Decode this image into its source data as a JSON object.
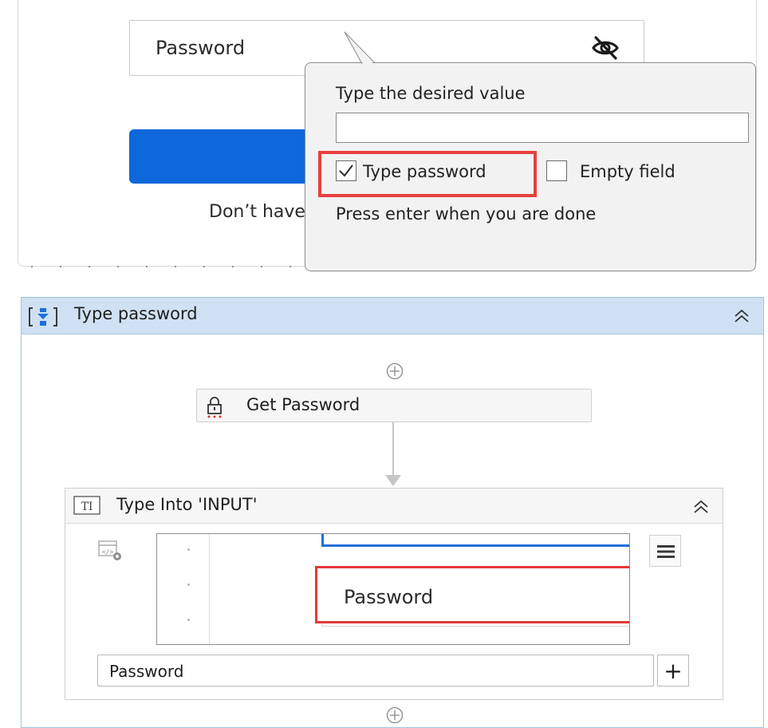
{
  "login_form": {
    "password_placeholder": "Password",
    "signup_text": "Don’t have an account?",
    "button_color": "#0e67db"
  },
  "callout": {
    "title": "Type the desired value",
    "value_input": "",
    "type_password_label": "Type password",
    "type_password_checked": true,
    "empty_field_label": "Empty field",
    "empty_field_checked": false,
    "hint": "Press enter when you are done",
    "highlight_color": "#e8403e"
  },
  "sequence": {
    "title": "Type password",
    "activities": [
      {
        "name": "Get Password",
        "icon": "lock-icon"
      }
    ],
    "type_into": {
      "title": "Type Into 'INPUT'",
      "preview_text": "Password",
      "value": "Password",
      "add_button_label": "+"
    }
  }
}
